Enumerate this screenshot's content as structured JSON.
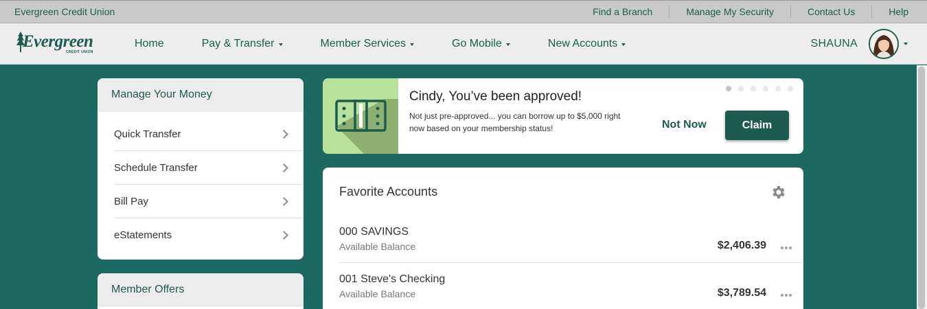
{
  "utility_bar": {
    "brand": "Evergreen Credit Union",
    "links": [
      "Find a Branch",
      "Manage My Security",
      "Contact Us",
      "Help"
    ]
  },
  "logo": {
    "name": "Evergreen",
    "sub": "CREDIT UNION"
  },
  "nav": {
    "items": [
      "Home",
      "Pay & Transfer",
      "Member Services",
      "Go Mobile",
      "New Accounts"
    ],
    "user_name": "SHAUNA"
  },
  "manage_money": {
    "title": "Manage Your Money",
    "items": [
      "Quick Transfer",
      "Schedule Transfer",
      "Bill Pay",
      "eStatements"
    ]
  },
  "member_offers": {
    "title": "Member Offers"
  },
  "promo": {
    "title": "Cindy, You’ve been approved!",
    "body": "Not just pre-approved... you can borrow up to $5,000 right now based on your membership status!",
    "not_now": "Not Now",
    "claim": "Claim",
    "slide_count": 6,
    "active_slide": 1
  },
  "favorites": {
    "title": "Favorite Accounts",
    "accounts": [
      {
        "name": "000 SAVINGS",
        "label": "Available Balance",
        "balance": "$2,406.39"
      },
      {
        "name": "001 Steve's Checking",
        "label": "Available Balance",
        "balance": "$3,789.54"
      }
    ]
  },
  "colors": {
    "brand_green": "#1d5b50",
    "background": "#1c6a5f",
    "promo_art": "#b8e29c"
  }
}
